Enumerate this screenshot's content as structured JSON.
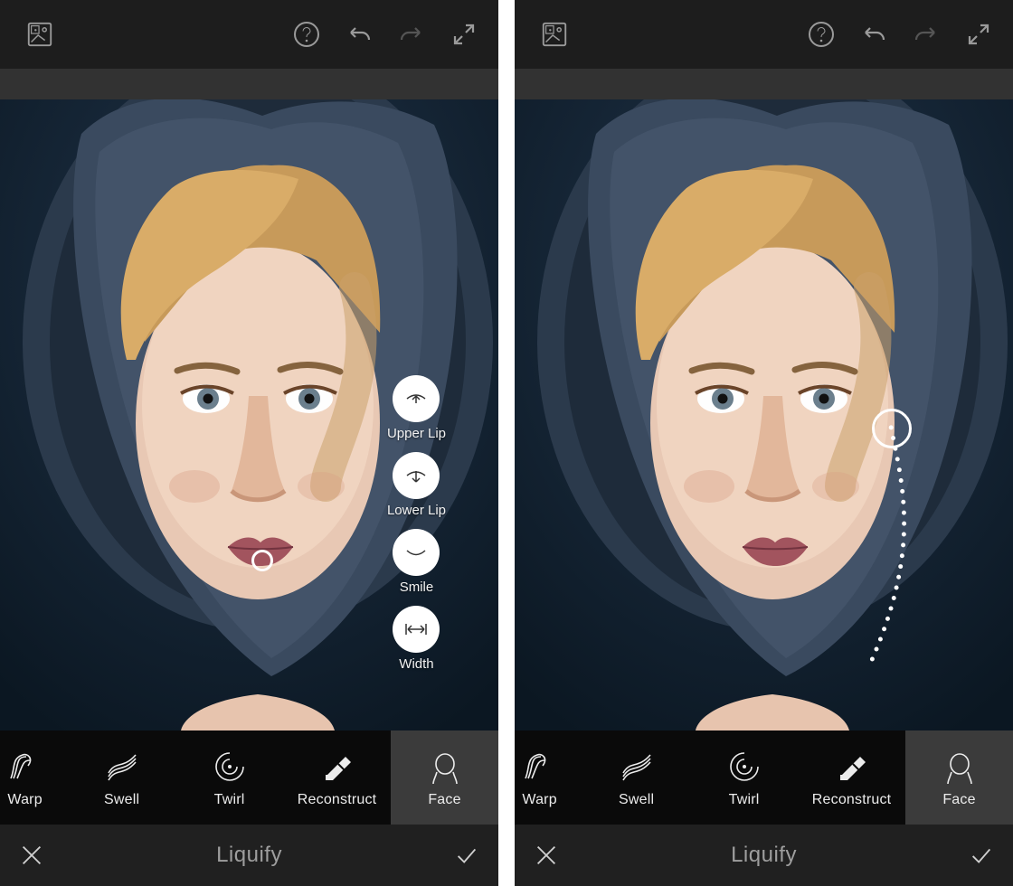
{
  "left": {
    "editor_title": "Liquify",
    "tools": [
      "Warp",
      "Swell",
      "Twirl",
      "Reconstruct",
      "Face"
    ],
    "selected_tool_index": 4,
    "face_options": [
      {
        "id": "upper-lip",
        "label": "Upper Lip"
      },
      {
        "id": "lower-lip",
        "label": "Lower Lip"
      },
      {
        "id": "smile",
        "label": "Smile"
      },
      {
        "id": "width",
        "label": "Width"
      }
    ]
  },
  "right": {
    "editor_title": "Liquify",
    "tools": [
      "Warp",
      "Swell",
      "Twirl",
      "Reconstruct",
      "Face"
    ],
    "selected_tool_index": 4
  }
}
